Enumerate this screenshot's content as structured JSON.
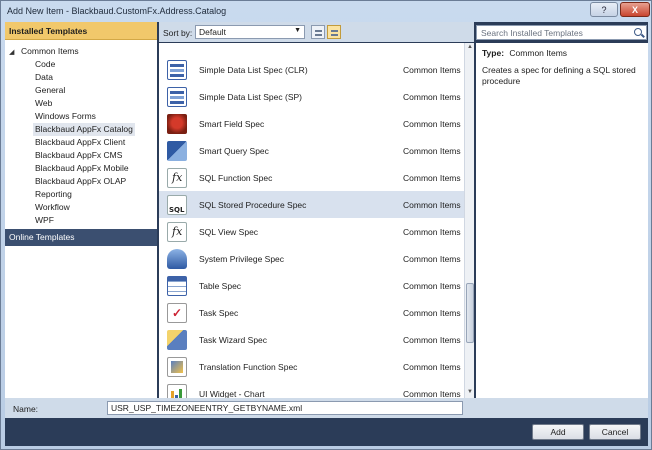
{
  "window": {
    "title": "Add New Item - Blackbaud.CustomFx.Address.Catalog",
    "help_label": "?",
    "close_label": "X"
  },
  "left_panel": {
    "installed_header": "Installed Templates",
    "root": "Common Items",
    "items": [
      "Code",
      "Data",
      "General",
      "Web",
      "Windows Forms",
      "Blackbaud AppFx Catalog",
      "Blackbaud AppFx Client",
      "Blackbaud AppFx CMS",
      "Blackbaud AppFx Mobile",
      "Blackbaud AppFx OLAP",
      "Reporting",
      "Workflow",
      "WPF"
    ],
    "selected": "Blackbaud AppFx Catalog",
    "online_header": "Online Templates"
  },
  "sortbar": {
    "label": "Sort by:",
    "value": "Default"
  },
  "search": {
    "placeholder": "Search Installed Templates"
  },
  "templates": [
    {
      "name": "Simple Data List Spec (CLR)",
      "category": "Common Items",
      "icon": "data-list-icon"
    },
    {
      "name": "Simple Data List Spec (SP)",
      "category": "Common Items",
      "icon": "data-list-icon"
    },
    {
      "name": "Smart Field Spec",
      "category": "Common Items",
      "icon": "smart-field-icon"
    },
    {
      "name": "Smart Query Spec",
      "category": "Common Items",
      "icon": "smart-query-icon"
    },
    {
      "name": "SQL Function Spec",
      "category": "Common Items",
      "icon": "function-icon"
    },
    {
      "name": "SQL Stored Procedure Spec",
      "category": "Common Items",
      "icon": "sql-icon"
    },
    {
      "name": "SQL View Spec",
      "category": "Common Items",
      "icon": "function-icon"
    },
    {
      "name": "System Privilege Spec",
      "category": "Common Items",
      "icon": "privilege-icon"
    },
    {
      "name": "Table Spec",
      "category": "Common Items",
      "icon": "table-icon"
    },
    {
      "name": "Task Spec",
      "category": "Common Items",
      "icon": "task-icon"
    },
    {
      "name": "Task Wizard Spec",
      "category": "Common Items",
      "icon": "wizard-icon"
    },
    {
      "name": "Translation Function Spec",
      "category": "Common Items",
      "icon": "translation-icon"
    },
    {
      "name": "UI Widget - Chart",
      "category": "Common Items",
      "icon": "chart-icon"
    }
  ],
  "selected_template": "SQL Stored Procedure Spec",
  "details": {
    "type_label": "Type:",
    "type_value": "Common Items",
    "description": "Creates a spec for defining a SQL stored procedure"
  },
  "name_field": {
    "label": "Name:",
    "value": "USR_USP_TIMEZONEENTRY_GETBYNAME.xml"
  },
  "buttons": {
    "add": "Add",
    "cancel": "Cancel"
  }
}
